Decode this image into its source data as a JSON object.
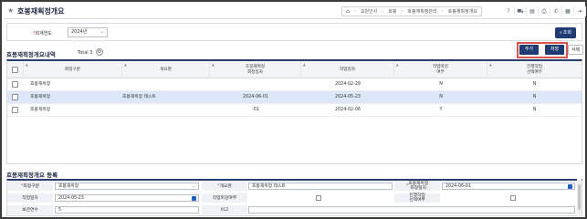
{
  "page": {
    "title": "호봉재획정개요",
    "breadcrumb": [
      "교원인사",
      "호봉",
      "호봉재획정관리",
      "호봉재획정개요"
    ]
  },
  "search": {
    "year_label": "회계연도",
    "year_value": "2024년",
    "search_button": "조회"
  },
  "list": {
    "title": "호봉재획정개요내역",
    "total_label": "Total 3",
    "buttons": {
      "add": "추가",
      "save": "저장",
      "delete": "삭제"
    },
    "columns": [
      "회정구분",
      "개요명",
      "호봉재획정\n회정일자",
      "작업일자",
      "작업마감\n여부",
      "진행작업\n선택여부"
    ],
    "rows": [
      {
        "type": "호봉재획정",
        "name": "",
        "fix_date": "",
        "work_date": "2024-02-29",
        "closed": "N",
        "selected": "N"
      },
      {
        "type": "호봉재획정",
        "name": "호봉재획정 테스트",
        "fix_date": "2024-06-01",
        "work_date": "2024-05-23",
        "closed": "N",
        "selected": "N"
      },
      {
        "type": "호봉재획정",
        "name": "",
        "fix_date": "-01",
        "work_date": "2024-02-06",
        "closed": "Y",
        "selected": "N"
      }
    ]
  },
  "detail": {
    "title": "호봉재획정개요 등록",
    "fields": {
      "type_label": "회정구분",
      "type_value": "호봉재획정",
      "name_label": "개요명",
      "name_value": "호봉재획정 테스트",
      "fix_date_label": "호봉재획정\n회정일자",
      "fix_date_value": "2024-06-01",
      "work_date_label": "작업일자",
      "work_date_value": "2024-05-23",
      "closed_label": "작업마감여부",
      "selected_label": "진행작업\n선택여부",
      "retention_label": "보관연수",
      "retention_value": "5",
      "remark_label": "비고",
      "remark_value": ""
    }
  },
  "colors": {
    "primary": "#1f3b73",
    "highlight_border": "#d9534f",
    "selected_row": "#dde7f7",
    "required": "#d9534f"
  }
}
